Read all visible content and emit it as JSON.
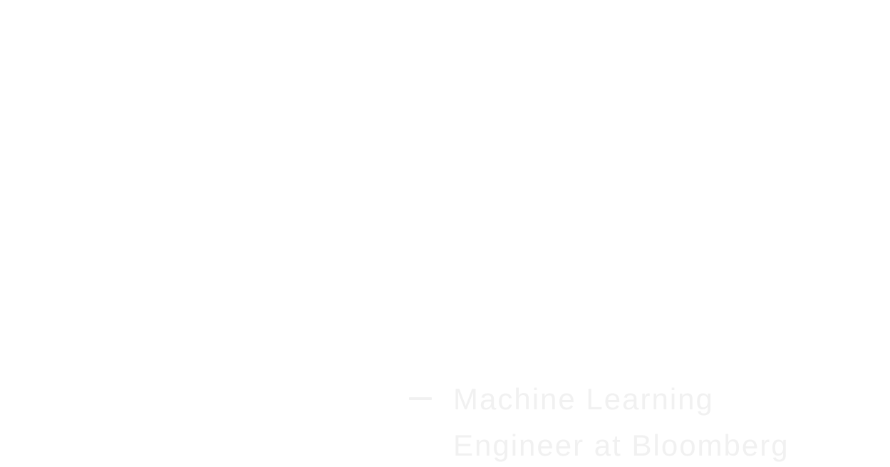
{
  "attribution": {
    "role_text": "Machine Learning Engineer at Bloomberg"
  },
  "colors": {
    "background": "#ffffff",
    "text": "#f1f1f1",
    "dash": "#f1f1f1"
  }
}
